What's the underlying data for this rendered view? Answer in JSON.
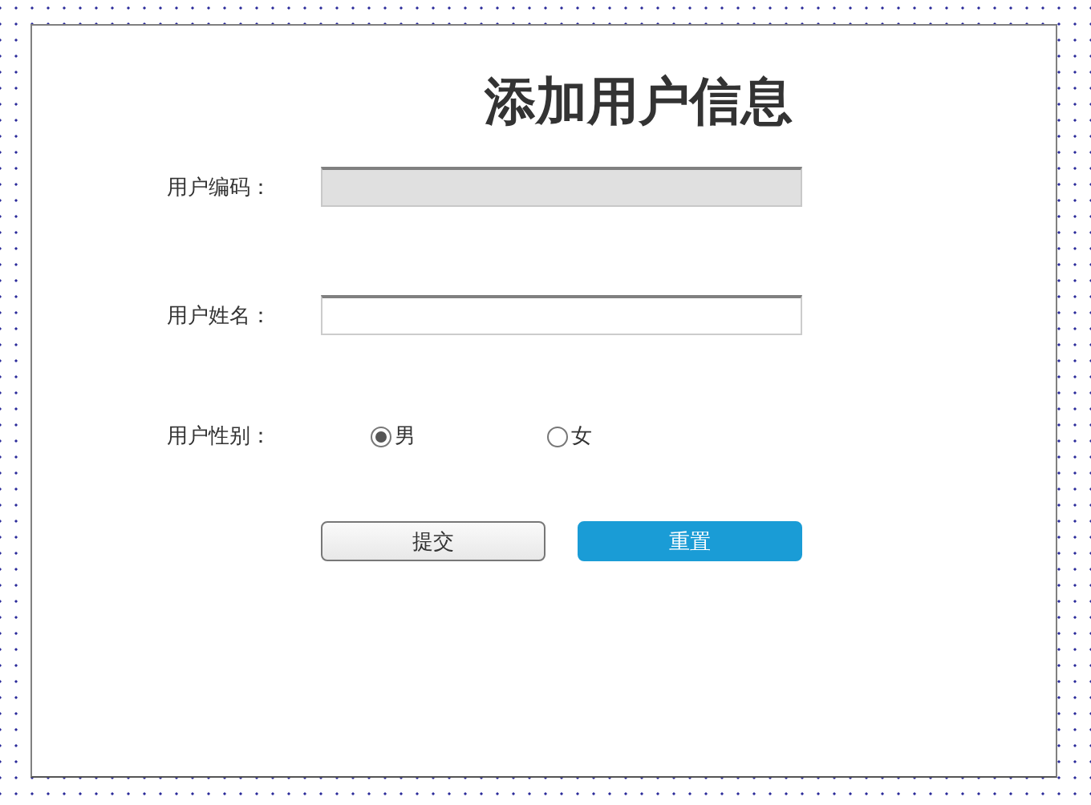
{
  "title": "添加用户信息",
  "fields": [
    {
      "label": "用户编码：",
      "disabled": true
    },
    {
      "label": "用户姓名：",
      "disabled": false
    }
  ],
  "gender": {
    "label": "用户性别：",
    "options": [
      {
        "label": "男",
        "selected": true
      },
      {
        "label": "女",
        "selected": false
      }
    ]
  },
  "buttons": [
    {
      "label": "提交",
      "kind": "default"
    },
    {
      "label": "重置",
      "kind": "primary"
    }
  ]
}
